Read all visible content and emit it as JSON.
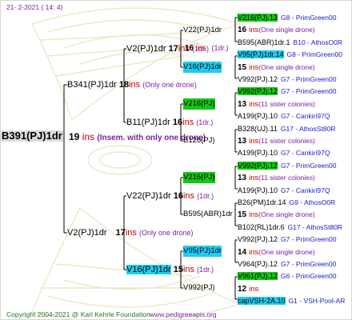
{
  "header": {
    "date": "21-   2-2021  (  14:   4)"
  },
  "footer": {
    "copyright": "Copyright 2004-2021 @ Karl Kehrle Foundation",
    "site": "www.pedigreeapis.org"
  },
  "colors": {
    "ins_label": "#c00000",
    "note": "#7a1fa2",
    "ref": "#1a1ac8",
    "highlight_green": "#14c814",
    "highlight_cyan": "#1ecdf0",
    "lines": "#000000"
  },
  "root": {
    "name": "B391(PJ)1dr",
    "ins_num": "19",
    "ins_label": "ins",
    "note": "(Insem. with only one drone)"
  },
  "gen2": [
    {
      "name": "B341(PJ)1dr",
      "ins_num": "18",
      "ins_label": "ins",
      "note": "(Only one drone)"
    },
    {
      "name": "V2(PJ)1dr",
      "ins_num": "17",
      "ins_label": "ins",
      "note": "(Only one drone)"
    }
  ],
  "gen3": [
    {
      "name": "V2(PJ)1dr",
      "ins_num": "17",
      "ins_label": "ins",
      "note": "(1dr.)"
    },
    {
      "name": "B11(PJ)1dr",
      "ins_num": "16",
      "ins_label": "ins",
      "note": "(1dr.)"
    },
    {
      "name": "V22(PJ)1dr",
      "ins_num": "16",
      "ins_label": "ins",
      "note": "(1dr.)"
    },
    {
      "name": "V16(PJ)1dr",
      "ins_num": "15",
      "ins_label": "ins",
      "note": "(1dr.)"
    }
  ],
  "gen4": [
    {
      "name": "V22(PJ)1dr",
      "ins_num": "16",
      "ins_label": "ins",
      "note": "(1dr.)"
    },
    {
      "name": "V16(PJ)1dr",
      "ins_num": "",
      "ins_label": "",
      "note": ""
    },
    {
      "name": "V216(PJ)",
      "ins_num": "",
      "ins_label": "",
      "note": ""
    },
    {
      "name": "B126(PJ)",
      "ins_num": "",
      "ins_label": "",
      "note": ""
    },
    {
      "name": "V216(PJ)",
      "ins_num": "",
      "ins_label": "",
      "note": ""
    },
    {
      "name": "B595(ABR)1dr",
      "ins_num": "",
      "ins_label": "",
      "note": ""
    },
    {
      "name": "V95(PJ)1dr",
      "ins_num": "",
      "ins_label": "",
      "note": ""
    },
    {
      "name": "V992(PJ)",
      "ins_num": "",
      "ins_label": "",
      "note": ""
    }
  ],
  "gen5": [
    {
      "name": "V216(PJ).13",
      "ref": "G8 - PrimGreen00"
    },
    {
      "ins_num": "16",
      "ins_label": "ins",
      "note": "(One single drone)"
    },
    {
      "name": "B595(ABR)1dr.1",
      "ref": "B10 - AthosO0R"
    },
    {
      "name": "V95(PJ)1dr.14",
      "ref": "G8 - PrimGreen00"
    },
    {
      "ins_num": "15",
      "ins_label": "ins",
      "note": "(One single drone)"
    },
    {
      "name": "V992(PJ).12",
      "ref": "G7 - PrimGreen00"
    },
    {
      "name": "V992(PJ).12",
      "ref": "G7 - PrimGreen00"
    },
    {
      "ins_num": "13",
      "ins_label": "ins",
      "note": "(11 sister colonies)"
    },
    {
      "name": "A199(PJ).10",
      "ref": "G7 - Cankiri97Q"
    },
    {
      "name": "B328(UJ).11",
      "ref": "G17 - AthosSt80R"
    },
    {
      "ins_num": "13",
      "ins_label": "ins",
      "note": "(11 sister colonies)"
    },
    {
      "name": "A199(PJ).10",
      "ref": "G7 - Cankiri97Q"
    },
    {
      "name": "V992(PJ).12",
      "ref": "G7 - PrimGreen00"
    },
    {
      "ins_num": "13",
      "ins_label": "ins",
      "note": "(11 sister colonies)"
    },
    {
      "name": "A199(PJ).10",
      "ref": "G7 - Cankiri97Q"
    },
    {
      "name": "B26(PM)1dr.14",
      "ref": "G9 - AthosO0R"
    },
    {
      "ins_num": "15",
      "ins_label": "ins",
      "note": "(One single drone)"
    },
    {
      "name": "B102(RL)1dr.6",
      "ref": "G17 - AthosSt80R"
    },
    {
      "name": "V992(PJ).12",
      "ref": "G7 - PrimGreen00"
    },
    {
      "ins_num": "14",
      "ins_label": "ins",
      "note": "(One single drone)"
    },
    {
      "name": "V964(PJ).12",
      "ref": "G7 - PrimGreen00"
    },
    {
      "name": "V961(PJ).12",
      "ref": "G6 - PrimGreen00"
    },
    {
      "ins_num": "12",
      "ins_label": "ins",
      "note": ""
    },
    {
      "name": "capVSH-2A.10",
      "ref": "G1 - VSH-Pool-AR"
    }
  ]
}
